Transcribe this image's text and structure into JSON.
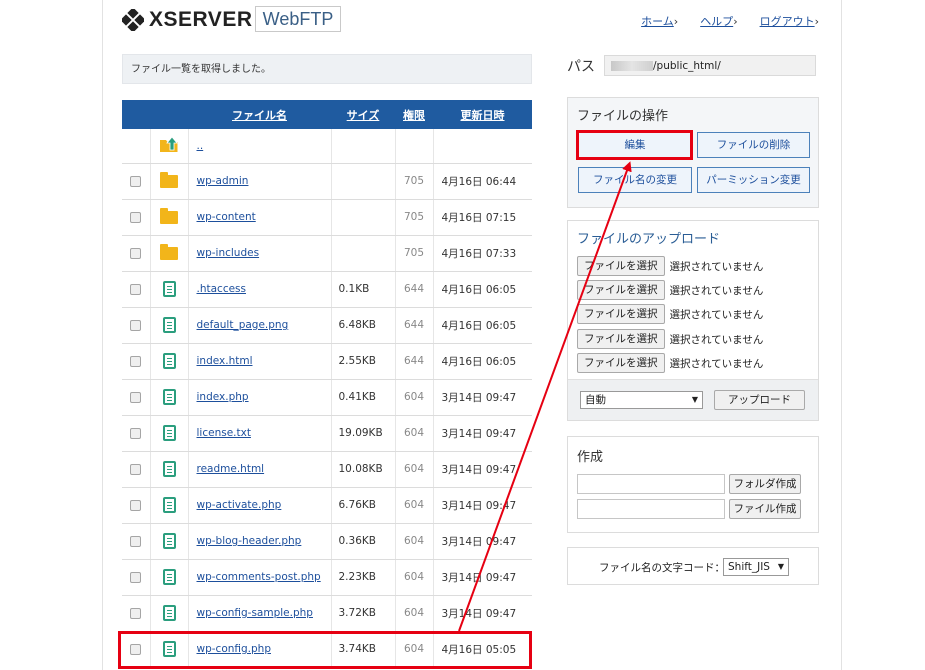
{
  "header": {
    "logo_text": "XSERVER",
    "app_badge": "WebFTP",
    "nav": [
      {
        "label": "ホーム"
      },
      {
        "label": "ヘルプ"
      },
      {
        "label": "ログアウト"
      }
    ]
  },
  "message": "ファイル一覧を取得しました。",
  "table": {
    "columns": [
      "ファイル名",
      "サイズ",
      "権限",
      "更新日時"
    ],
    "parent_link": "..",
    "rows": [
      {
        "type": "folder",
        "name": "wp-admin",
        "size": "",
        "perm": "705",
        "date": "4月16日 06:44"
      },
      {
        "type": "folder",
        "name": "wp-content",
        "size": "",
        "perm": "705",
        "date": "4月16日 07:15"
      },
      {
        "type": "folder",
        "name": "wp-includes",
        "size": "",
        "perm": "705",
        "date": "4月16日 07:33"
      },
      {
        "type": "file",
        "name": ".htaccess",
        "size": "0.1KB",
        "perm": "644",
        "date": "4月16日 06:05"
      },
      {
        "type": "file",
        "name": "default_page.png",
        "size": "6.48KB",
        "perm": "644",
        "date": "4月16日 06:05"
      },
      {
        "type": "file",
        "name": "index.html",
        "size": "2.55KB",
        "perm": "644",
        "date": "4月16日 06:05"
      },
      {
        "type": "file",
        "name": "index.php",
        "size": "0.41KB",
        "perm": "604",
        "date": "3月14日 09:47"
      },
      {
        "type": "file",
        "name": "license.txt",
        "size": "19.09KB",
        "perm": "604",
        "date": "3月14日 09:47"
      },
      {
        "type": "file",
        "name": "readme.html",
        "size": "10.08KB",
        "perm": "604",
        "date": "3月14日 09:47"
      },
      {
        "type": "file",
        "name": "wp-activate.php",
        "size": "6.76KB",
        "perm": "604",
        "date": "3月14日 09:47"
      },
      {
        "type": "file",
        "name": "wp-blog-header.php",
        "size": "0.36KB",
        "perm": "604",
        "date": "3月14日 09:47"
      },
      {
        "type": "file",
        "name": "wp-comments-post.php",
        "size": "2.23KB",
        "perm": "604",
        "date": "3月14日 09:47"
      },
      {
        "type": "file",
        "name": "wp-config-sample.php",
        "size": "3.72KB",
        "perm": "604",
        "date": "3月14日 09:47"
      },
      {
        "type": "file",
        "name": "wp-config.php",
        "size": "3.74KB",
        "perm": "604",
        "date": "4月16日 05:05"
      }
    ]
  },
  "path": {
    "label": "パス",
    "value": "/public_html/"
  },
  "file_ops": {
    "title": "ファイルの操作",
    "edit": "編集",
    "delete": "ファイルの削除",
    "rename": "ファイル名の変更",
    "permission": "パーミッション変更"
  },
  "upload": {
    "title": "ファイルのアップロード",
    "choose_label": "ファイルを選択",
    "none_selected": "選択されていません",
    "mode": "自動",
    "upload_button": "アップロード"
  },
  "create": {
    "title": "作成",
    "folder_button": "フォルダ作成",
    "file_button": "ファイル作成"
  },
  "encoding": {
    "label": "ファイル名の文字コード：",
    "value": "Shift_JIS"
  },
  "colors": {
    "header_blue": "#1f5ba0",
    "highlight_red": "#e60012",
    "folder": "#f2b51a",
    "file_icon": "#2b9e7e"
  }
}
